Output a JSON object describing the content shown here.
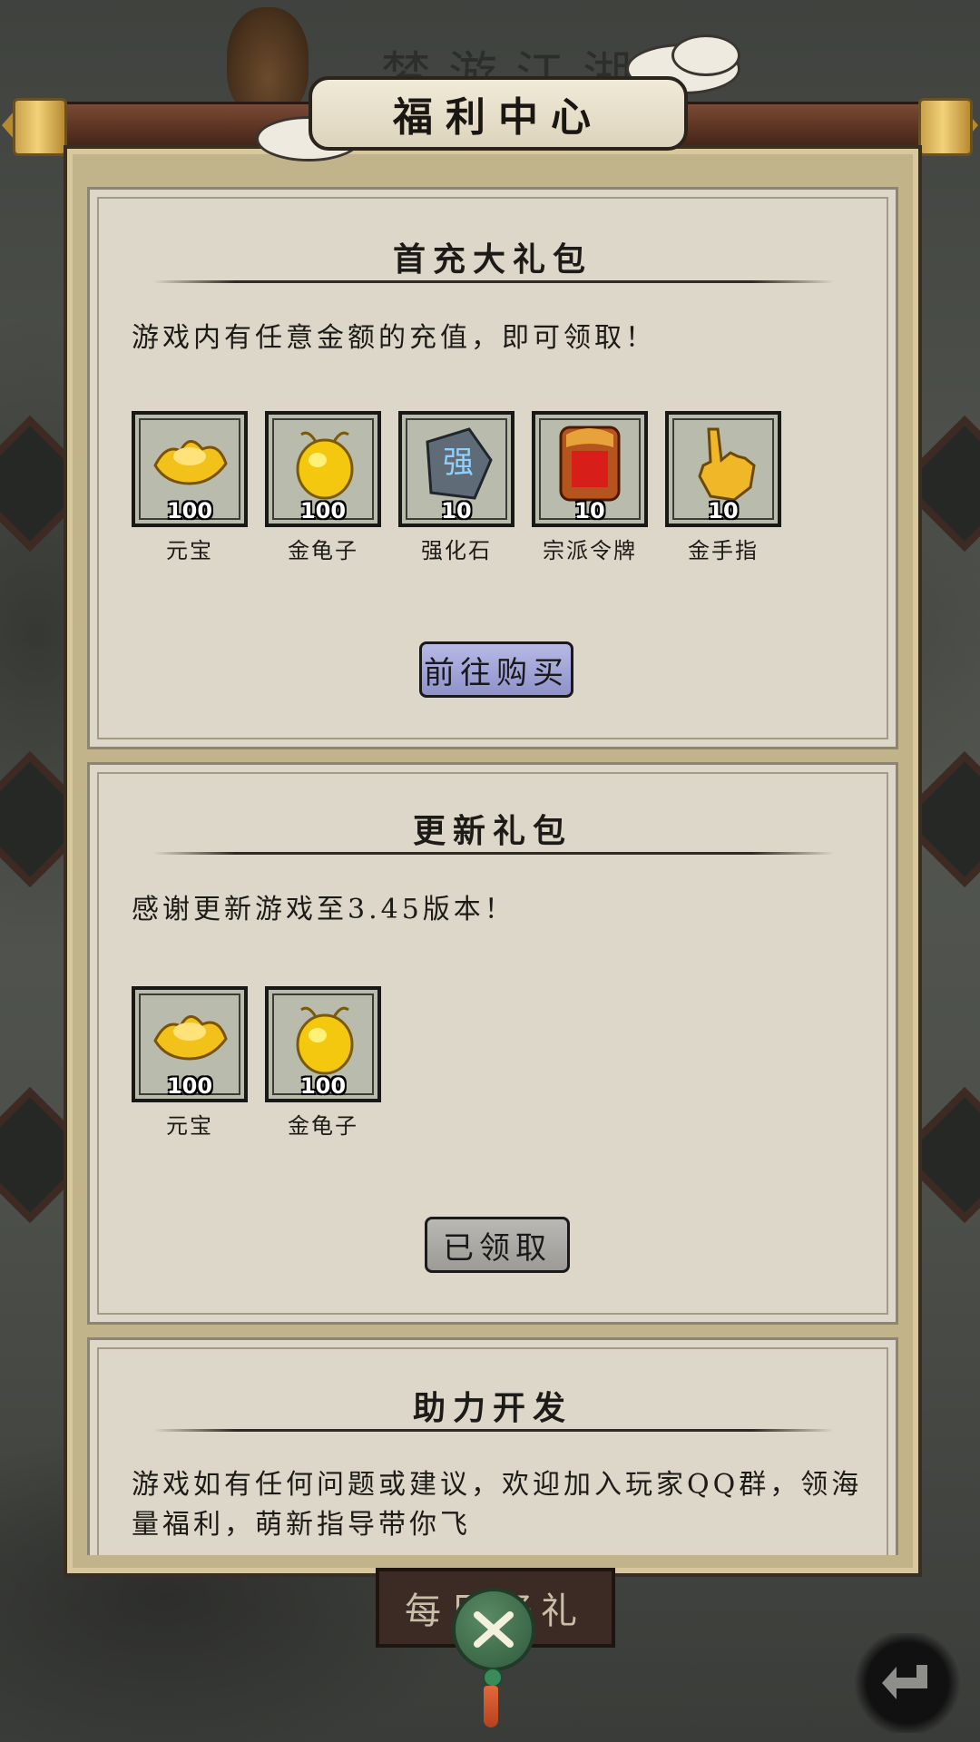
{
  "header": {
    "title": "福利中心",
    "background_title": "梦游江湖"
  },
  "sections": [
    {
      "title": "首充大礼包",
      "description": "游戏内有任意金额的充值，即可领取！",
      "items": [
        {
          "name": "元宝",
          "qty": "100",
          "icon": "gold-ingot-icon"
        },
        {
          "name": "金龟子",
          "qty": "100",
          "icon": "golden-beetle-icon"
        },
        {
          "name": "强化石",
          "qty": "10",
          "icon": "enhance-stone-icon"
        },
        {
          "name": "宗派令牌",
          "qty": "10",
          "icon": "sect-token-icon"
        },
        {
          "name": "金手指",
          "qty": "10",
          "icon": "golden-finger-icon"
        }
      ],
      "button": "前往购买"
    },
    {
      "title": "更新礼包",
      "description": "感谢更新游戏至3.45版本！",
      "items": [
        {
          "name": "元宝",
          "qty": "100",
          "icon": "gold-ingot-icon"
        },
        {
          "name": "金龟子",
          "qty": "100",
          "icon": "golden-beetle-icon"
        }
      ],
      "button": "已领取"
    },
    {
      "title": "助力开发",
      "description": "游戏如有任何问题或建议，欢迎加入玩家QQ群，领海量福利，萌新指导带你飞"
    }
  ],
  "footer": {
    "daily_button": "每日好礼"
  },
  "colors": {
    "buy_button": "#a3a5d8",
    "claimed_button": "#aaa9a5",
    "panel_bg": "#ddd7c9",
    "frame": "#c2b48a"
  }
}
